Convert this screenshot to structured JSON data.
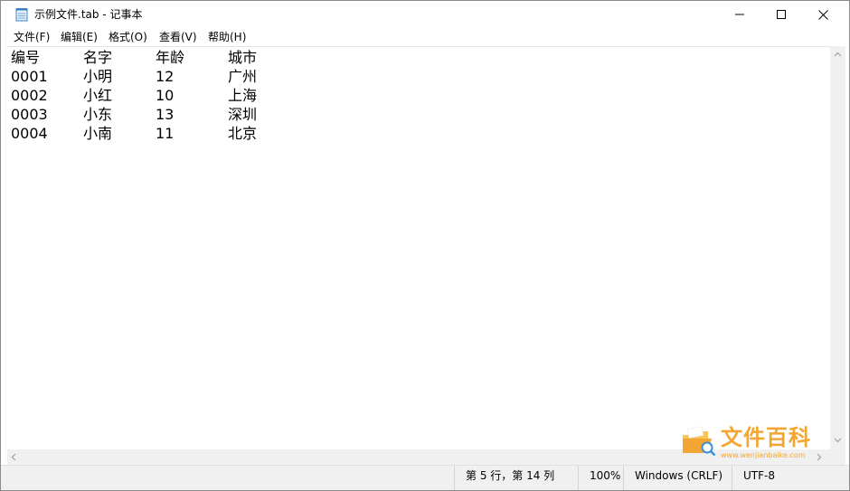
{
  "window": {
    "title": "示例文件.tab - 记事本"
  },
  "menu": {
    "items": [
      "文件(F)",
      "编辑(E)",
      "格式(O)",
      "查看(V)",
      "帮助(H)"
    ]
  },
  "document": {
    "rows": [
      [
        "编号",
        "名字",
        "年龄",
        "城市"
      ],
      [
        "0001",
        "小明",
        "12",
        "广州"
      ],
      [
        "0002",
        "小红",
        "10",
        "上海"
      ],
      [
        "0003",
        "小东",
        "13",
        "深圳"
      ],
      [
        "0004",
        "小南",
        "11",
        "北京"
      ]
    ]
  },
  "status": {
    "position": "第 5 行，第 14 列",
    "zoom": "100%",
    "line_ending": "Windows (CRLF)",
    "encoding": "UTF-8"
  },
  "watermark": {
    "text": "文件百科",
    "url": "www.wenjianbaike.com"
  },
  "icons": {
    "app": "notepad-icon",
    "minimize": "minimize-icon",
    "maximize": "maximize-icon",
    "close": "close-icon"
  },
  "colors": {
    "watermark": "#f3a634",
    "scrollbar": "#f0f0f0"
  }
}
